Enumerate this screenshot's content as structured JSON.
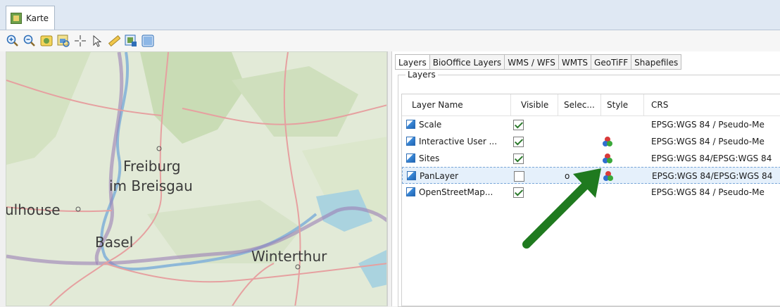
{
  "window_tab": {
    "title": "Karte"
  },
  "toolbar": {
    "tools": [
      "zoom-in-icon",
      "zoom-out-icon",
      "zoom-extent-icon",
      "zoom-layer-icon",
      "pan-crosshair-icon",
      "select-pointer-icon",
      "measure-ruler-icon",
      "export-map-icon",
      "window-icon"
    ]
  },
  "map": {
    "labels": {
      "freiburg_1": "Freiburg",
      "freiburg_2": "im Breisgau",
      "mulhouse": "ulhouse",
      "basel": "Basel",
      "winterthur": "Winterthur"
    }
  },
  "panel": {
    "tabs": [
      "Layers",
      "BioOffice Layers",
      "WMS / WFS",
      "WMTS",
      "GeoTiFF",
      "Shapefiles"
    ],
    "active_tab": "Layers",
    "group_label": "Layers",
    "columns": [
      "Layer Name",
      "Visible",
      "Selec...",
      "Style",
      "CRS"
    ],
    "rows": [
      {
        "name": "Scale",
        "visible": true,
        "selectable": "",
        "style": false,
        "crs": "EPSG:WGS 84 / Pseudo-Me"
      },
      {
        "name": "Interactive User ...",
        "visible": true,
        "selectable": "",
        "style": true,
        "crs": "EPSG:WGS 84 / Pseudo-Me"
      },
      {
        "name": "Sites",
        "visible": true,
        "selectable": "",
        "style": true,
        "crs": "EPSG:WGS 84/EPSG:WGS 84"
      },
      {
        "name": "PanLayer",
        "visible": false,
        "selectable": "o",
        "style": true,
        "crs": "EPSG:WGS 84/EPSG:WGS 84"
      },
      {
        "name": "OpenStreetMap...",
        "visible": true,
        "selectable": "",
        "style": false,
        "crs": "EPSG:WGS 84 / Pseudo-Me"
      }
    ],
    "selected_row": 3
  },
  "colors": {
    "arrow": "#1f7a1f",
    "selection": "#e5f0fb",
    "check": "#2c7a2c"
  }
}
